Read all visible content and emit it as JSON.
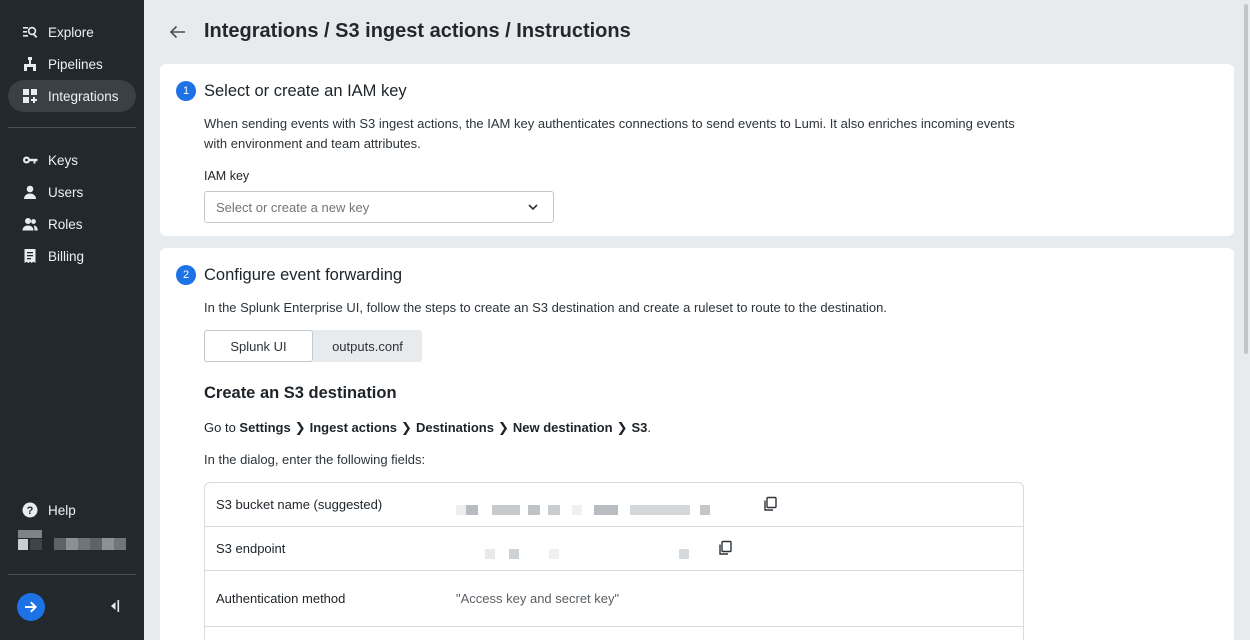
{
  "sidebar": {
    "items": [
      {
        "label": "Explore",
        "icon": "explore-icon"
      },
      {
        "label": "Pipelines",
        "icon": "pipelines-icon"
      },
      {
        "label": "Integrations",
        "icon": "integrations-icon",
        "active": true
      },
      {
        "label": "Keys",
        "icon": "key-icon"
      },
      {
        "label": "Users",
        "icon": "user-icon"
      },
      {
        "label": "Roles",
        "icon": "roles-icon"
      },
      {
        "label": "Billing",
        "icon": "billing-icon"
      }
    ],
    "help_label": "Help"
  },
  "header": {
    "title": "Integrations / S3 ingest actions / Instructions"
  },
  "step1": {
    "number": "1",
    "title": "Select or create an IAM key",
    "description": "When sending events with S3 ingest actions, the IAM key authenticates connections to send events to Lumi. It also enriches incoming events with environment and team attributes.",
    "field_label": "IAM key",
    "select_placeholder": "Select or create a new key"
  },
  "step2": {
    "number": "2",
    "title": "Configure event forwarding",
    "description": "In the Splunk Enterprise UI, follow the steps to create an S3 destination and create a ruleset to route to the destination.",
    "tabs": [
      "Splunk UI",
      "outputs.conf"
    ],
    "active_tab": "Splunk UI",
    "section_title": "Create an S3 destination",
    "goto_prefix": "Go to",
    "goto_path": [
      "Settings",
      "Ingest actions",
      "Destinations",
      "New destination",
      "S3"
    ],
    "goto_suffix": ".",
    "dialog_text": "In the dialog, enter the following fields:",
    "fields": [
      {
        "name": "S3 bucket name (suggested)",
        "value": ""
      },
      {
        "name": "S3 endpoint",
        "value": ""
      },
      {
        "name": "Authentication method",
        "value": "\"Access key and secret key\""
      }
    ]
  },
  "colors": {
    "accent": "#1d72e6",
    "sidebar_bg": "#23282d",
    "page_bg": "#e8ebee"
  }
}
